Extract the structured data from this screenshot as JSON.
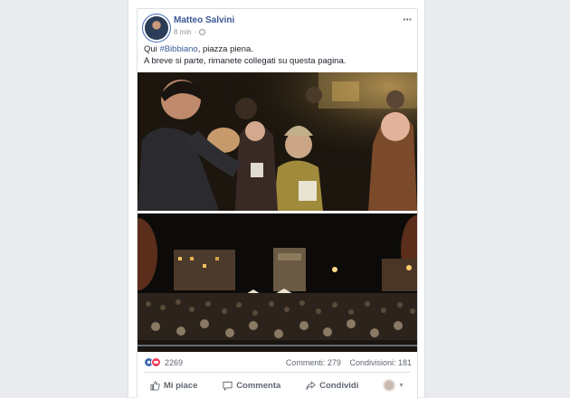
{
  "post": {
    "author": "Matteo Salvini",
    "time": "8 min",
    "text_line1_prefix": "Qui ",
    "hashtag": "#Bibbiano",
    "text_line1_suffix": ", piazza piena.",
    "text_line2": "A breve si parte, rimanete collegati su questa pagina."
  },
  "footer": {
    "reaction_count": "2269",
    "comments": "Commenti: 279",
    "shares": "Condivisioni: 181"
  },
  "actions": {
    "like": "Mi piace",
    "comment": "Commenta",
    "share": "Condividi"
  },
  "icons": [
    "avatar",
    "globe-icon",
    "more-icon",
    "like-reaction-icon",
    "love-reaction-icon",
    "thumbs-up-icon",
    "comment-icon",
    "share-icon",
    "profile-avatar"
  ],
  "colors": {
    "link": "#385898",
    "like_blue": "#4267b2",
    "love_red": "#f33e58",
    "background": "#e9ebee"
  }
}
